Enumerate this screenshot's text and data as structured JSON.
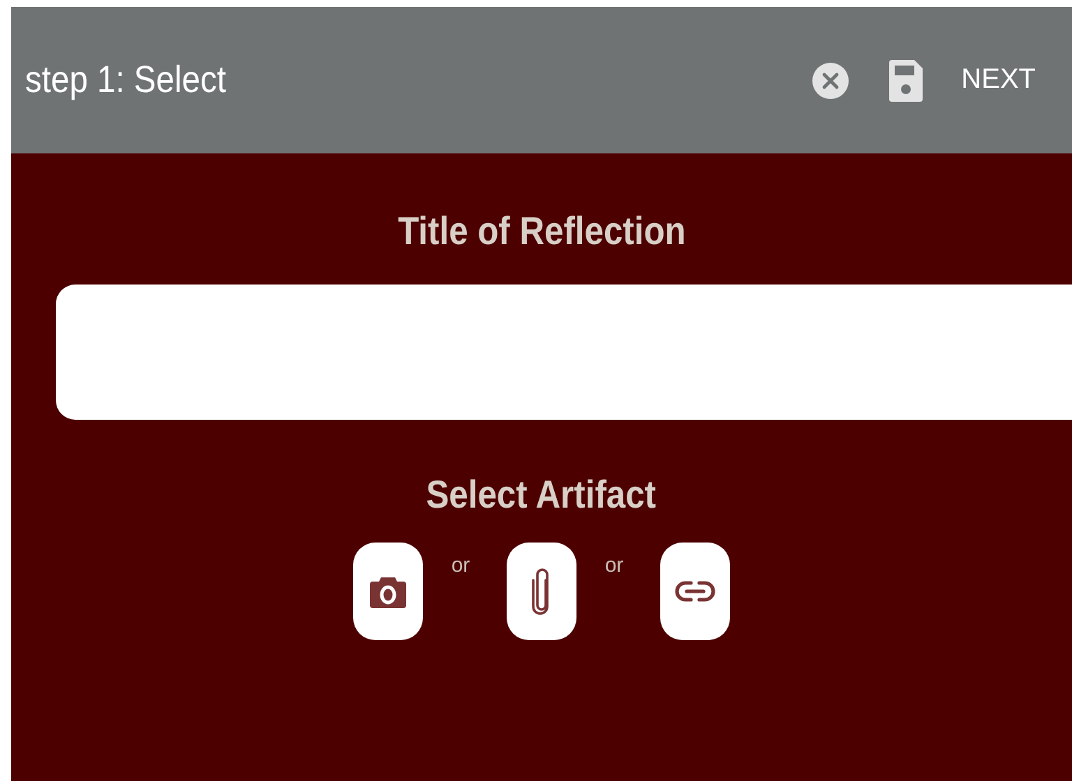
{
  "header": {
    "title": "step 1: Select",
    "next_button": "NEXT"
  },
  "reflection": {
    "label": "Title of Reflection"
  },
  "artifact": {
    "label": "Select Artifact",
    "options": [
      {
        "kind": "camera"
      },
      {
        "kind": "attachment"
      },
      {
        "kind": "link"
      }
    ],
    "separators": [
      "or",
      "or"
    ]
  }
}
